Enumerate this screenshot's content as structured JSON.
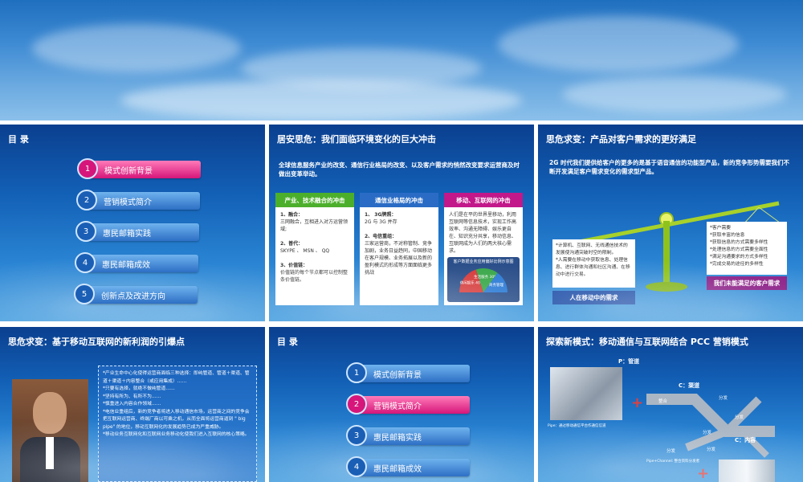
{
  "slides": {
    "toc1": {
      "title": "目 录",
      "items": [
        {
          "num": "1",
          "label": "模式创新背景",
          "active": true
        },
        {
          "num": "2",
          "label": "营销模式简介",
          "active": false
        },
        {
          "num": "3",
          "label": "惠民邮箱实践",
          "active": false
        },
        {
          "num": "4",
          "label": "惠民邮箱成效",
          "active": false
        },
        {
          "num": "5",
          "label": "创新点及改进方向",
          "active": false
        }
      ]
    },
    "s2": {
      "title": "居安思危：我们面临环境变化的巨大冲击",
      "intro": "全球信息服务产业的改变、通信行业格局的改变、以及客户需求的悄然改变要求运营商及时做出变革举动。",
      "columns": [
        {
          "head": "产业、技术融合的冲击",
          "color": "#4caf2c",
          "lines": [
            "1、融合：",
            "三网融合，互相进入对方运营领域;",
            "",
            "2、普代：",
            "SKYPE 、 MSN 、 QQ",
            "",
            "3、价值链：",
            "价值链的每个节点都可以控制整条价值链。"
          ]
        },
        {
          "head": "通信业格局的冲击",
          "color": "#2a6cc5",
          "lines": [
            "1、   3G牌照：",
            "2G 与 3G 并存",
            "",
            "2、电信重组：",
            "三家运营商，不对称管制、竞争加剧，业务日益趋同，中国移动在客户规模、业务拓展以及新的盈利模式的形成等方面面临更多挑战"
          ]
        },
        {
          "head": "移动、互联网的冲击",
          "color": "#c2188a",
          "lines": [
            "人们是在平的世界里移动，利用互联网等信息技术，实现工作高效率、沟通无障碍、娱乐更自在、知识充分共享，移动信息、互联网成为人们的两大核心需求。"
          ]
        }
      ],
      "pie": {
        "title": "客户数据业务应用偏好比例示意图",
        "slices": [
          {
            "label": "休闲娱乐",
            "value": 40,
            "text": "40%",
            "color": "#d63c3c"
          },
          {
            "label": "生活服务",
            "value": 30,
            "text": "30%",
            "color": "#3aa84a"
          },
          {
            "label": "商务管理",
            "value": 30,
            "text": "",
            "color": "#2c7bd6"
          }
        ]
      }
    },
    "s3": {
      "title": "思危求变：产品对客户需求的更好满足",
      "intro": "2G 时代我们提供给客户的更多的是基于语音通信的功能型产品，新的竞争形势需要我们不断开发满足客户需求变化的需求型产品。",
      "left_lines": [
        "*计算机、互联网、无线通信技术的发展使沟通突破时空的限制。",
        "*人需要在移动中获取信息、处理信息、进行群体沟通和社区沟通、在移动中进行交易。"
      ],
      "left_tag": "人在移动中的需求",
      "right_lines": [
        "*客户需要",
        "*获取丰富的信息",
        "*获取信息的方式需要多样性",
        "*处理信息的方式需要全面性",
        "*满足沟通要求的方式多样性",
        "*完成交易的途径的多样性"
      ],
      "right_tag": "我们未能满足的客户需求"
    },
    "s4": {
      "title": "思危求变：基于移动互联网的新利润的引爆点",
      "lines": [
        "*产业生命中心化使得运营商面临三种选择：即纯管道、管道＋渠道、管道＋渠道＋内容整合（或应用集成）……",
        "*只要有选择，就绝不做纯管道……",
        "*坚持有所为、有所不为……",
        "*慎重进入内容合作领域……",
        "*电信业重组后，新的竞争者将进入移动通信市场，运营商之间的竞争会把互联网运营商、终端厂商以可乘之机，从而全面将运营商逼到 \" big pipe\" 的地位，移动互联网化的发展趋势已成为严重威胁。",
        "*移动业务互联网化和互联网业务移动化使我们进入互联网的核心策略。"
      ]
    },
    "toc2": {
      "title": "目 录",
      "items": [
        {
          "num": "1",
          "label": "模式创新背景",
          "active": false
        },
        {
          "num": "2",
          "label": "营销模式简介",
          "active": true
        },
        {
          "num": "3",
          "label": "惠民邮箱实践",
          "active": false
        },
        {
          "num": "4",
          "label": "惠民邮箱成效",
          "active": false
        }
      ]
    },
    "s6": {
      "title": "探索新模式：移动通信与互联网结合 PCC 营销模式",
      "p_label": "P：管道",
      "c_channel": "C：渠道",
      "c_content": "C：内容",
      "pipe_caption": "Pipe：通过移动通信平台作通信信道",
      "channel_caption": "Pipe+Channel: 整合资料分发者",
      "nodes": [
        "整合",
        "分发",
        "分发",
        "分发",
        "分发",
        "分发"
      ],
      "plus": "+"
    }
  },
  "colors": {
    "pink": "#d6167a",
    "blue": "#2d6fc4",
    "green": "#4caf2c",
    "slide_bg": "#1260b6"
  }
}
